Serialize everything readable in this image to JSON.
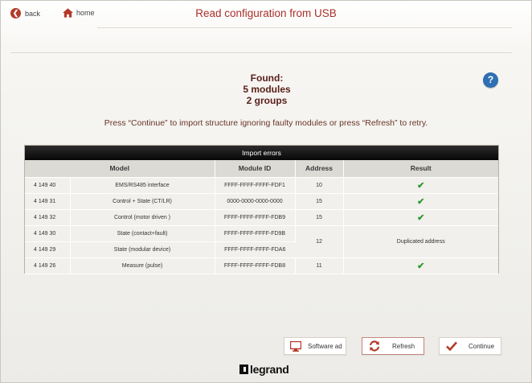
{
  "header": {
    "back_label": "back",
    "home_label": "home",
    "title": "Read configuration from USB"
  },
  "summary": {
    "line1": "Found:",
    "line2": "5 modules",
    "line3": "2 groups"
  },
  "instructions": "Press “Continue” to import structure ignoring faulty modules or press “Refresh” to retry.",
  "help_icon": "?",
  "table": {
    "title": "Import errors",
    "columns": [
      "Model",
      "Module ID",
      "Address",
      "Result"
    ],
    "rows": [
      {
        "ref": "4 149 40",
        "model": "EMS/RS485 interface",
        "id": "FFFF-FFFF-FFFF-FDF1",
        "address": "10",
        "result": "✔"
      },
      {
        "ref": "4 149 31",
        "model": "Control + State (CT/LR)",
        "id": "0000-0000-0000-0000",
        "address": "15",
        "result": "✔"
      },
      {
        "ref": "4 149 32",
        "model": "Control (motor driven )",
        "id": "FFFF-FFFF-FFFF-FDB9",
        "address": "15",
        "result": "✔"
      },
      {
        "ref": "4 149 30",
        "model": "State (contact+fault)",
        "id": "FFFF-FFFF-FFFF-FD9B",
        "address": "12",
        "result": "Duplicated address"
      },
      {
        "ref": "4 149 29",
        "model": "State (modular device)",
        "id": "FFFF-FFFF-FFFF-FDA6"
      },
      {
        "ref": "4 149 26",
        "model": "Measure (pulse)",
        "id": "FFFF-FFFF-FFFF-FDB8",
        "address": "11",
        "result": "✔"
      }
    ]
  },
  "buttons": {
    "software": "Software ad",
    "refresh": "Refresh",
    "continue": "Continue"
  },
  "logo": "legrand",
  "colors": {
    "accent": "#a9302a",
    "check": "#2b9a2b",
    "help": "#2f6fb3"
  }
}
